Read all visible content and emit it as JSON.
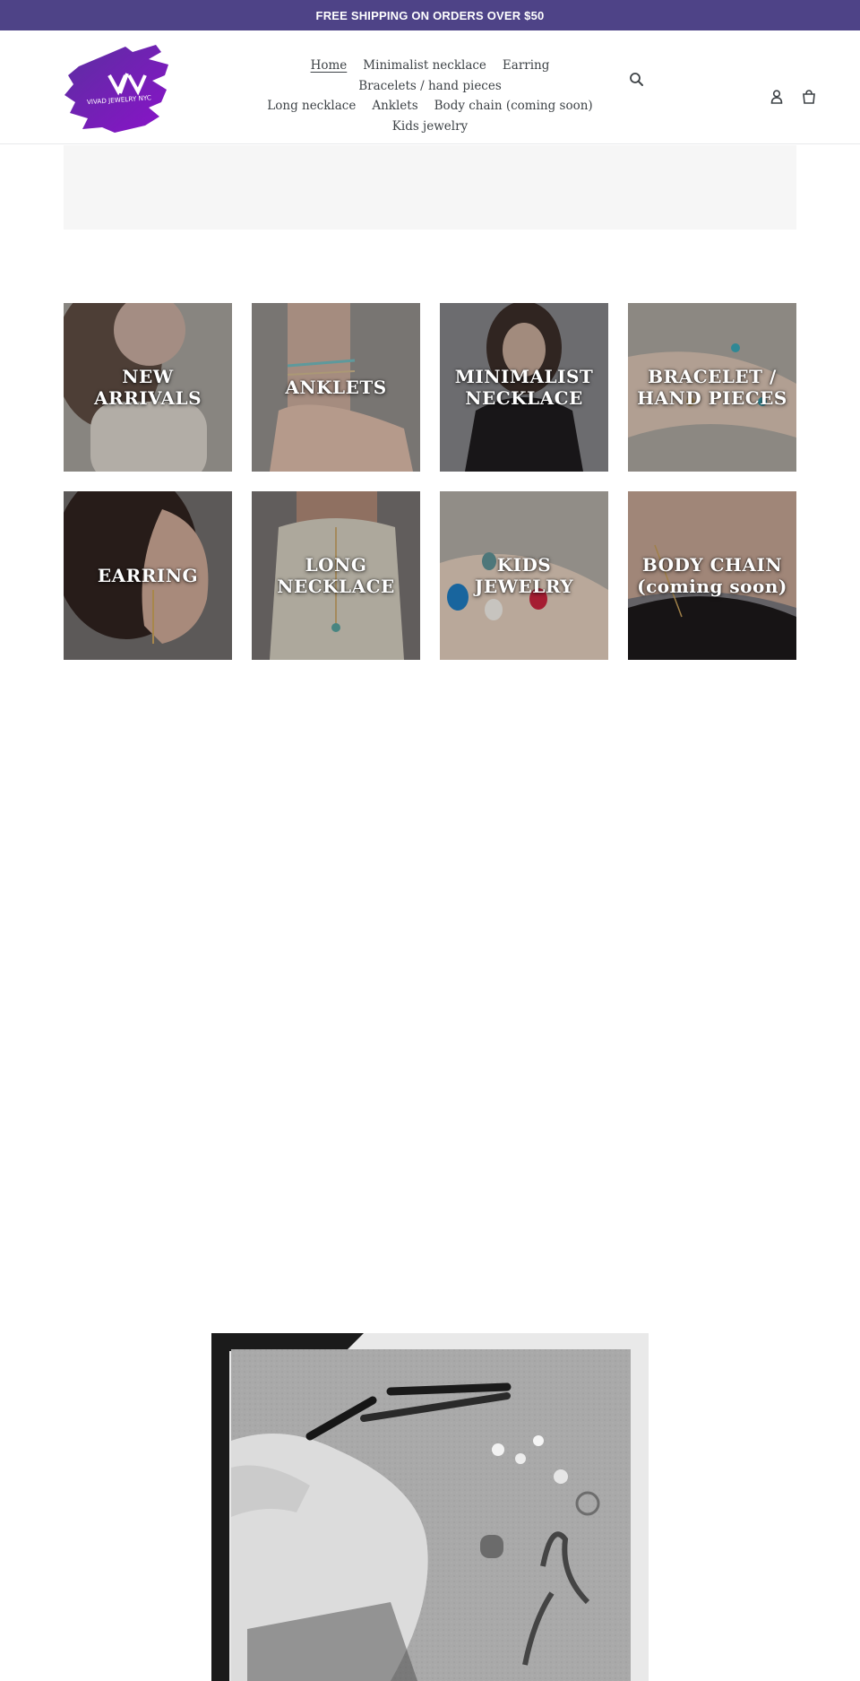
{
  "announcement": {
    "text": "FREE SHIPPING ON ORDERS OVER $50"
  },
  "brand": {
    "logo_text": "VIVAD JEWELRY NYC",
    "logo_mark": "V/\\"
  },
  "nav": {
    "items": [
      {
        "label": "Home",
        "active": true
      },
      {
        "label": "Minimalist necklace"
      },
      {
        "label": "Earring"
      },
      {
        "label": "Bracelets / hand pieces"
      },
      {
        "label": "Long necklace"
      },
      {
        "label": "Anklets"
      },
      {
        "label": "Body chain (coming soon)"
      },
      {
        "label": "Kids jewelry"
      }
    ]
  },
  "header_icons": {
    "search": "search-icon",
    "account": "account-icon",
    "cart": "cart-icon"
  },
  "collections": [
    {
      "label": "NEW\nARRIVALS",
      "tone": "#8f8b86"
    },
    {
      "label": "ANKLETS",
      "tone": "#8a8582"
    },
    {
      "label": "MINIMALIST\nNECKLACE",
      "tone": "#5a5a5e"
    },
    {
      "label": "BRACELET /\nHAND PIECES",
      "tone": "#86827b"
    },
    {
      "label": "EARRING",
      "tone": "#4a4344"
    },
    {
      "label": "LONG\nNECKLACE",
      "tone": "#6d6865"
    },
    {
      "label": "KIDS\nJEWELRY",
      "tone": "#8a8680"
    },
    {
      "label": "BODY CHAIN\n(coming soon)",
      "tone": "#5c5b60"
    }
  ],
  "colors": {
    "accent": "#4e4387",
    "text": "#3d4246",
    "placeholder": "#f6f6f6"
  }
}
